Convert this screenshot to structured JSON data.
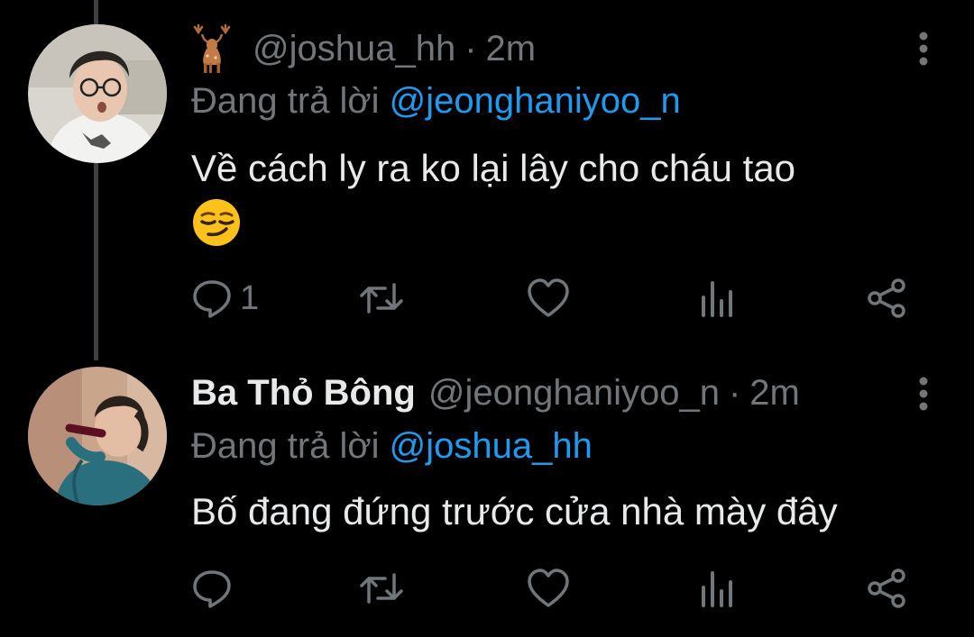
{
  "colors": {
    "background": "#000000",
    "primary_text": "#e7e9ea",
    "secondary_text": "#71767b",
    "accent": "#1d9bf0",
    "thread_line": "#3e4144"
  },
  "tweets": [
    {
      "display_name": "",
      "name_icon": "deer-icon",
      "handle": "@joshua_hh",
      "separator": "·",
      "time": "2m",
      "reply_prefix": "Đang trả lời",
      "reply_to": "@jeonghaniyoo_n",
      "text": "Về cách ly ra ko lại lây cho cháu tao",
      "emoji": "smirk-emoji",
      "actions": {
        "reply_count": "1",
        "retweet_count": "",
        "like_count": "",
        "stats_count": ""
      }
    },
    {
      "display_name": "Ba Thỏ Bông",
      "handle": "@jeonghaniyoo_n",
      "separator": "·",
      "time": "2m",
      "reply_prefix": "Đang trả lời",
      "reply_to": "@joshua_hh",
      "text": "Bố đang đứng trước cửa nhà mày đây",
      "actions": {
        "reply_count": "",
        "retweet_count": "",
        "like_count": "",
        "stats_count": ""
      }
    }
  ]
}
